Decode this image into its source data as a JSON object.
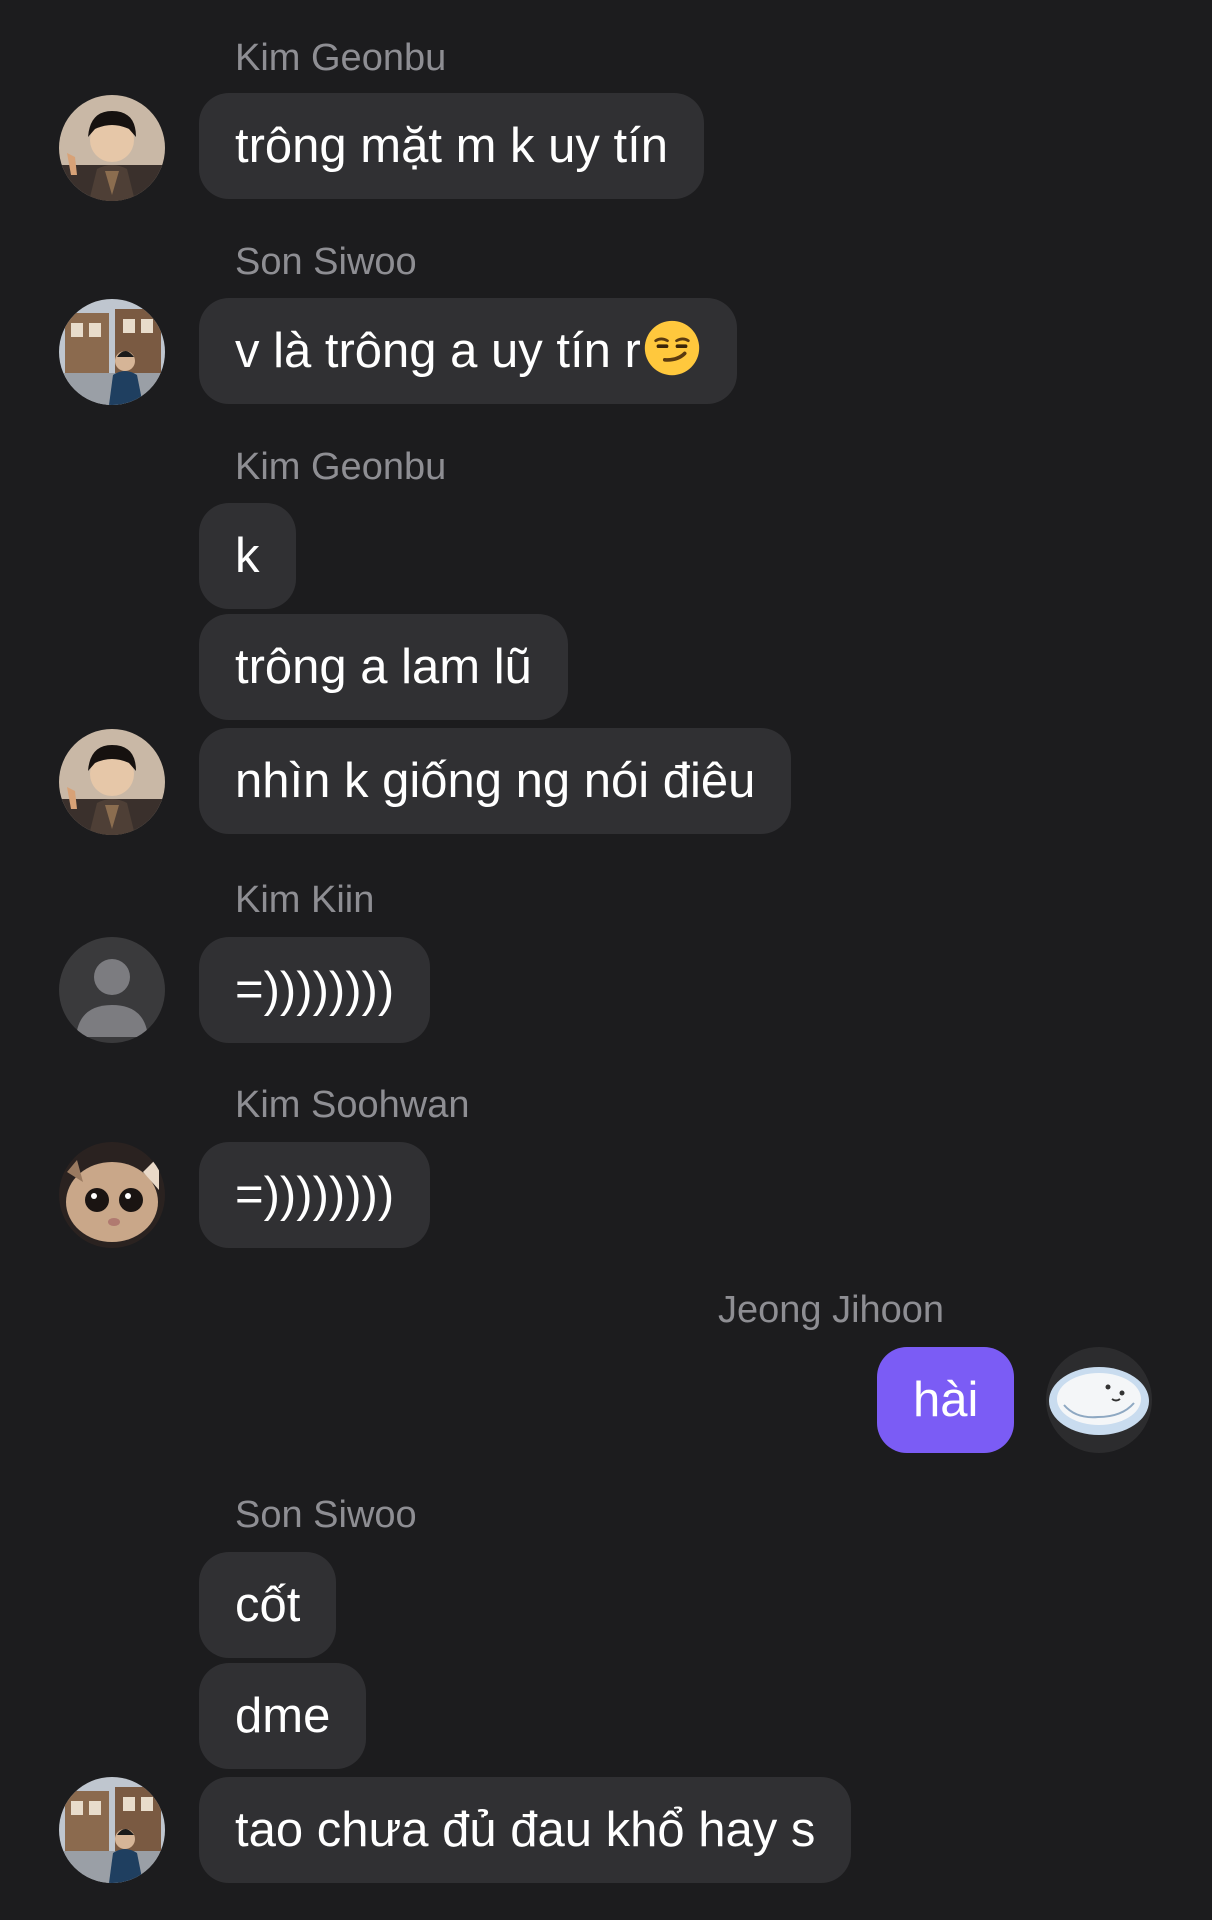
{
  "messages": [
    {
      "sender": "Kim Geonbu",
      "avatar": "photo-man-black-hair-icon",
      "texts": [
        "trông mặt m k uy tín"
      ]
    },
    {
      "sender": "Son Siwoo",
      "avatar": "photo-man-street-icon",
      "texts": [
        "v là trông a uy tín r"
      ],
      "emoji": "smirking-face-icon"
    },
    {
      "sender": "Kim Geonbu",
      "avatar": "photo-man-black-hair-icon",
      "texts": [
        "k",
        "trông a lam lũ",
        "nhìn k giống ng nói điêu"
      ]
    },
    {
      "sender": "Kim Kiin",
      "avatar": "default-user-icon",
      "texts": [
        "=))))))))"
      ]
    },
    {
      "sender": "Kim Soohwan",
      "avatar": "photo-cat-icon",
      "texts": [
        "=))))))))"
      ]
    },
    {
      "sender": "Jeong Jihoon",
      "avatar": "photo-cartoon-blob-icon",
      "texts": [
        "hài"
      ],
      "outgoing": true
    },
    {
      "sender": "Son Siwoo",
      "avatar": "photo-man-street-icon",
      "texts": [
        "cốt",
        "dme",
        "tao chưa đủ đau khổ hay s"
      ]
    }
  ],
  "colors": {
    "background": "#1c1c1e",
    "incoming_bubble": "#303033",
    "outgoing_bubble": "#7b5cf5",
    "sender_name": "#8e8e93"
  }
}
